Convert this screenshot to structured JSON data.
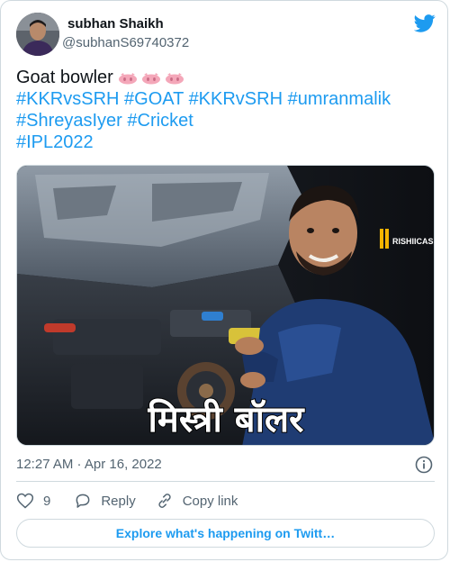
{
  "user": {
    "name": "subhan Shaikh",
    "handle": "@subhanS69740372"
  },
  "tweet": {
    "text": "Goat bowler",
    "emoji": "pig-nose-emoji",
    "hashtags_line1": [
      "#KKRvsSRH",
      "#GOAT",
      "#KKRvSRH",
      "#umranmalik"
    ],
    "hashtags_line2": [
      "#ShreyasIyer",
      "#Cricket"
    ],
    "hashtags_line3": [
      "#IPL2022"
    ]
  },
  "media": {
    "caption": "मिस्त्री बॉलर",
    "watermark": "RISHIICASM"
  },
  "meta": {
    "timestamp": "12:27 AM · Apr 16, 2022"
  },
  "actions": {
    "like_count": "9",
    "reply_label": "Reply",
    "copy_link_label": "Copy link"
  },
  "explore": {
    "label": "Explore what's happening on Twitt…"
  },
  "colors": {
    "accent": "#1d9bf0",
    "text": "#0f1419",
    "muted": "#536471",
    "border": "#cfd9de"
  }
}
